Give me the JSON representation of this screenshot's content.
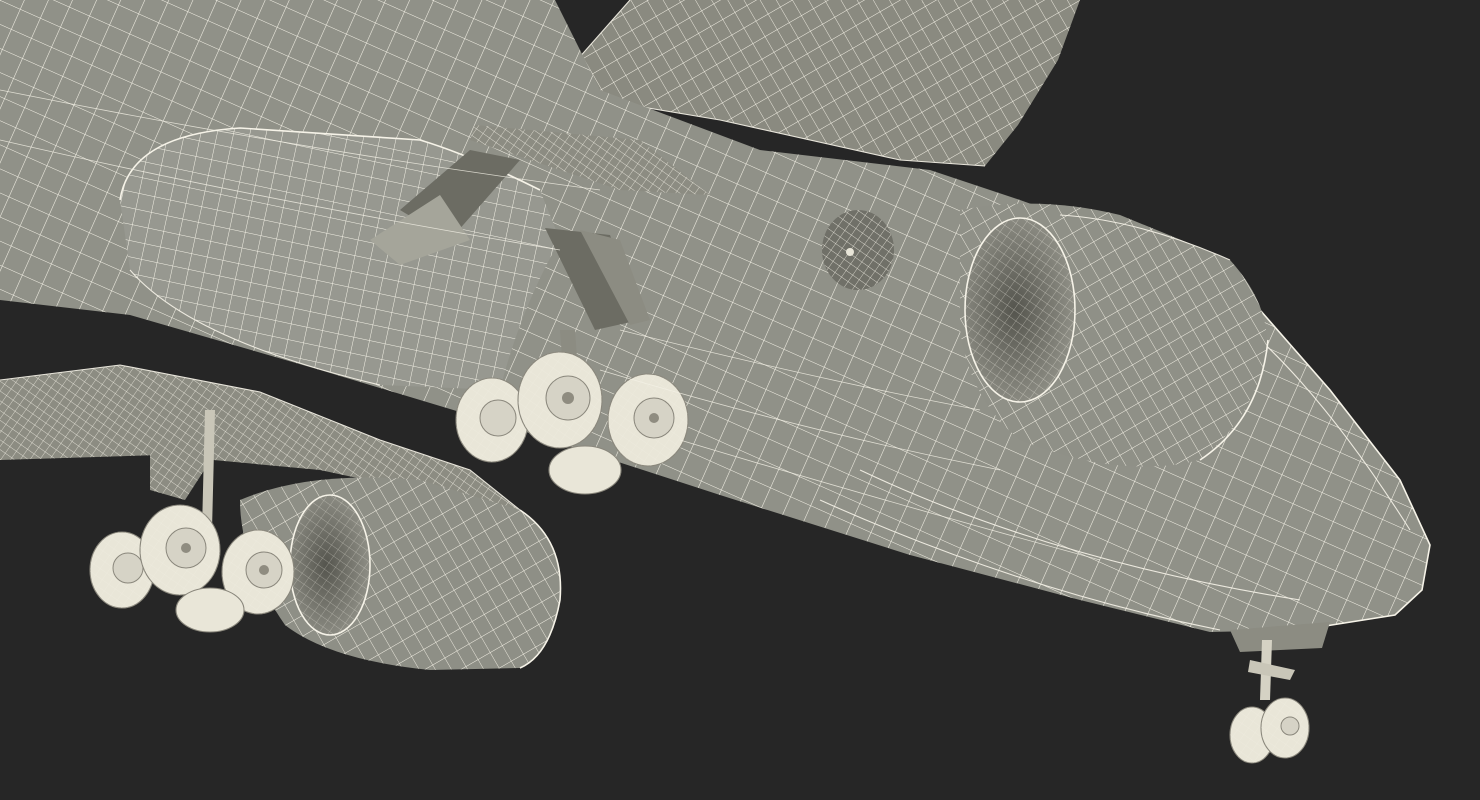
{
  "scene": {
    "background": "#262626",
    "surface": "#93948a",
    "wire": "#f4f1e6"
  }
}
